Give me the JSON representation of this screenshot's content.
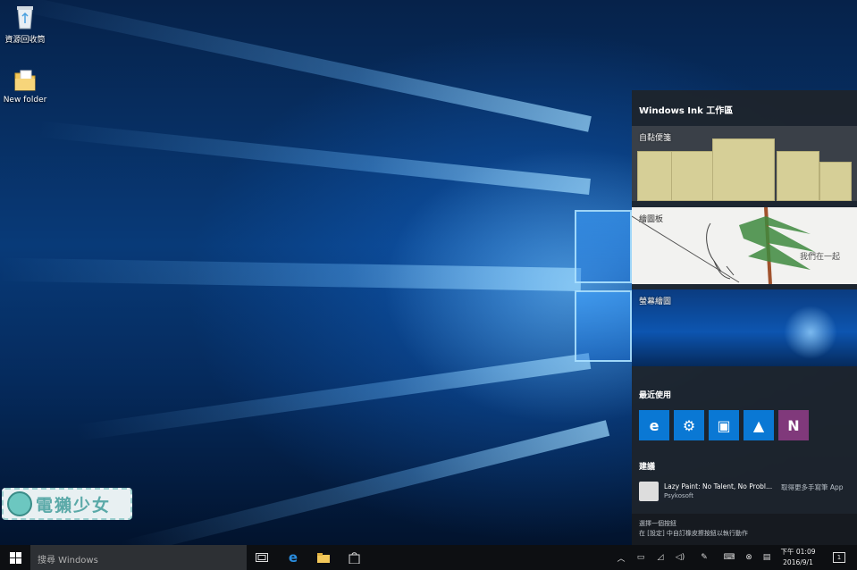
{
  "desktop": {
    "icons": [
      {
        "label": "資源回收筒",
        "icon": "recycle-bin-icon"
      },
      {
        "label": "New folder",
        "icon": "folder-icon"
      }
    ],
    "watermark": "電獺少女"
  },
  "ink_panel": {
    "title": "Windows Ink 工作區",
    "cards": {
      "sticky": "自黏便箋",
      "sketch": "繪圖板",
      "screen": "螢幕繪圖"
    },
    "recent_title": "最近使用",
    "recent_apps": [
      {
        "icon": "edge-icon",
        "color": "#0a78d4"
      },
      {
        "icon": "settings-gear-icon",
        "color": "#0a78d4"
      },
      {
        "icon": "store-icon",
        "color": "#0a78d4"
      },
      {
        "icon": "photos-icon",
        "color": "#0a78d4"
      },
      {
        "icon": "onenote-icon",
        "color": "#80397b"
      }
    ],
    "suggest_title": "建議",
    "suggestion": {
      "name": "Lazy Paint: No Talent, No Probl...",
      "publisher": "Psykosoft",
      "more": "取得更多手寫筆 App"
    },
    "footer_line1": "選擇一個按鈕",
    "footer_line2": "在 [設定] 中自訂橡皮擦按鈕以執行動作"
  },
  "taskbar": {
    "search_placeholder": "搜尋 Windows",
    "clock_time": "下午 01:09",
    "clock_date": "2016/9/1",
    "notification_count": "1"
  }
}
